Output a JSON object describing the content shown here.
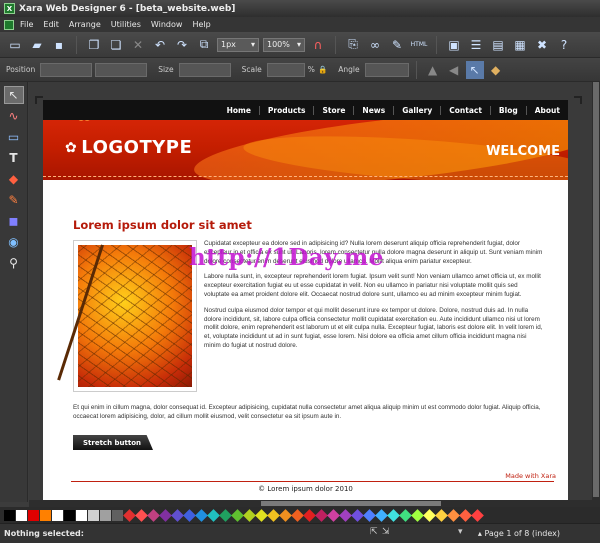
{
  "window": {
    "title": "Xara Web Designer 6 - [beta_website.web]",
    "app_icon": "X"
  },
  "menu": [
    "File",
    "Edit",
    "Arrange",
    "Utilities",
    "Window",
    "Help"
  ],
  "toolbar1": {
    "unit_value": "1px",
    "zoom_value": "100%",
    "html_label": "HTML"
  },
  "toolbar2": {
    "position_label": "Position",
    "size_label": "Size",
    "scale_label": "Scale",
    "angle_label": "Angle",
    "scale_unit": "%"
  },
  "page": {
    "nav": [
      "Home",
      "Products",
      "Store",
      "News",
      "Gallery",
      "Contact",
      "Blog",
      "About"
    ],
    "logotype": "LOGOTYPE",
    "welcome": "WELCOME",
    "heading": "Lorem ipsum dolor sit amet",
    "paragraphs": [
      "Cupidatat excepteur ea dolore sed in adipisicing id? Nulla lorem deserunt aliquip officia reprehenderit fugiat, dolor excepteur in et officia ex sunt ut. Laboris, lorem consectetur nulla dolore magna deserunt in aliquip ut. Sunt veniam minim dolore consectetur enim deserunt eiusmod dolore ullamco. Mollit aliqua enim pariatur excepteur.",
      "Labore nulla sunt, in, excepteur reprehenderit lorem fugiat. Ipsum velit sunt! Non veniam ullamco amet officia ut, ex mollit excepteur exercitation fugiat eu ut esse cupidatat in velit. Non eu ullamco in pariatur nisi voluptate mollit quis sed voluptate ea amet proident dolore elit. Occaecat nostrud dolore sunt, ullamco eu ad minim excepteur minim fugiat.",
      "Nostrud culpa eiusmod dolor tempor et qui mollit deserunt irure ex tempor ut dolore. Dolore, nostrud duis ad. In nulla dolore incididunt, sit, labore culpa officia consectetur mollit cupidatat exercitation eu. Aute incididunt ullamco nisi ut lorem mollit dolore, enim reprehenderit est laborum ut et elit culpa nulla. Excepteur fugiat, laboris est dolore elit. In velit lorem id, et, voluptate incididunt ut ad in sunt fugiat, esse lorem. Nisi dolore ea officia amet cillum officia incididunt magna nisi minim do fugiat ut nostrud dolore."
    ],
    "full_paragraph": "Et qui enim in cillum magna, dolor consequat id. Excepteur adipisicing, cupidatat nulla consectetur amet aliqua aliquip minim ut est commodo dolor fugiat. Aliquip officia, occaecat lorem adipisicing, dolor, ad cillum mollit eiusmod, velit consectetur ea sit ipsum aute in.",
    "stretch_button": "Stretch button",
    "made_with": "Made with Xara",
    "copyright": "© Lorem ipsum dolor 2010"
  },
  "watermark": "http://1Day.me",
  "status": {
    "selection": "Nothing selected:",
    "page_indicator": "Page 1 of 8 (index)"
  },
  "colors": {
    "header_red": "#c41e00",
    "heading_red": "#b51a0a",
    "watermark": "#c10fd0",
    "palette": [
      "#000000",
      "#ffffff",
      "#e00000",
      "#ff8000",
      "#ffffff",
      "#000000",
      "#ffffff",
      "#d0d0d0",
      "#a0a0a0",
      "#606060",
      "#e03030",
      "#ff5050",
      "#c04080",
      "#8030a0",
      "#6050d0",
      "#4060e0",
      "#2090e0",
      "#20c0c0",
      "#20a060",
      "#60c030",
      "#b0d020",
      "#e0e020",
      "#f0c020",
      "#f09020",
      "#f06020",
      "#e02020",
      "#c02060",
      "#d040a0",
      "#a040c0",
      "#7050e0",
      "#5080ff",
      "#40b0ff",
      "#40e0e0",
      "#40e080",
      "#a0ff40",
      "#ffff60",
      "#ffd040",
      "#ff9040",
      "#ff6040",
      "#ff4040"
    ]
  }
}
